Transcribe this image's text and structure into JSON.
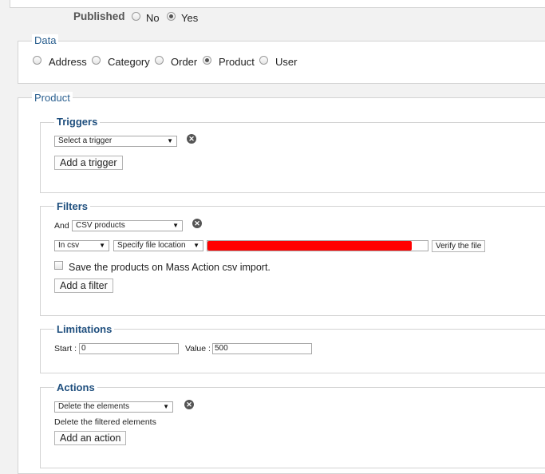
{
  "published": {
    "label": "Published",
    "options": [
      {
        "label": "No",
        "checked": false
      },
      {
        "label": "Yes",
        "checked": true
      }
    ]
  },
  "data_section": {
    "legend": "Data",
    "options": [
      {
        "label": "Address",
        "checked": false
      },
      {
        "label": "Category",
        "checked": false
      },
      {
        "label": "Order",
        "checked": false
      },
      {
        "label": "Product",
        "checked": true
      },
      {
        "label": "User",
        "checked": false
      }
    ]
  },
  "product_section": {
    "legend": "Product",
    "triggers": {
      "legend": "Triggers",
      "select_value": "Select a trigger",
      "add_label": "Add a trigger"
    },
    "filters": {
      "legend": "Filters",
      "and_label": "And",
      "filter_select_value": "CSV products",
      "in_csv_value": "In csv",
      "location_value": "Specify file location",
      "verify_label": "Verify the file",
      "checkbox_label": "Save the products on Mass Action csv import.",
      "checkbox_checked": false,
      "add_label": "Add a filter"
    },
    "limitations": {
      "legend": "Limitations",
      "start_label": "Start :",
      "start_value": "0",
      "value_label": "Value :",
      "value_value": "500"
    },
    "actions": {
      "legend": "Actions",
      "select_value": "Delete the elements",
      "description": "Delete the filtered elements",
      "add_label": "Add an action"
    }
  },
  "colors": {
    "legend": "#2a5f8f",
    "redaction": "#ff0000",
    "background": "#f2f2f2"
  }
}
